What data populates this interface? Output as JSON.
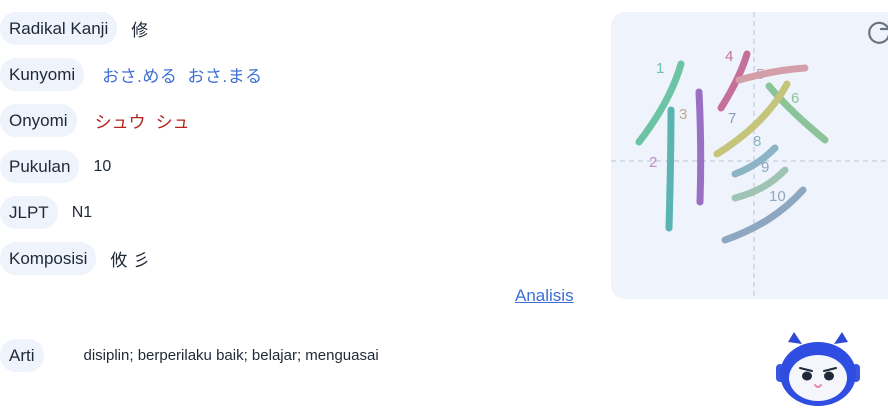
{
  "rows": {
    "radikal": {
      "label": "Radikal Kanji",
      "value": "修"
    },
    "kunyomi": {
      "label": "Kunyomi",
      "readings": [
        "おさ.める",
        "おさ.まる"
      ]
    },
    "onyomi": {
      "label": "Onyomi",
      "readings": [
        "シュウ",
        "シュ"
      ]
    },
    "pukulan": {
      "label": "Pukulan",
      "value": "10"
    },
    "jlpt": {
      "label": "JLPT",
      "value": "N1"
    },
    "komposisi": {
      "label": "Komposisi",
      "value": "攸 彡"
    }
  },
  "analysis_link": "Analisis",
  "arti": {
    "label": "Arti",
    "value": "disiplin; berperilaku baik; belajar; menguasai"
  },
  "stroke_order": {
    "numbers": [
      "1",
      "2",
      "3",
      "4",
      "5",
      "6",
      "7",
      "8",
      "9",
      "10"
    ],
    "colors": [
      "#6cc4a4",
      "#c98bc4",
      "#9b70c4",
      "#c4709a",
      "#d49fa8",
      "#8cc49a",
      "#c4c47a",
      "#8cb4c4",
      "#a0c4b4",
      "#8fa6c0"
    ]
  },
  "icons": {
    "reload": "reload-icon",
    "mascot": "robot-mascot-icon"
  },
  "colors": {
    "pill_bg": "#eef3fc",
    "kunyomi": "#3d6fd6",
    "onyomi": "#b3261e",
    "link": "#3d6fd6"
  }
}
